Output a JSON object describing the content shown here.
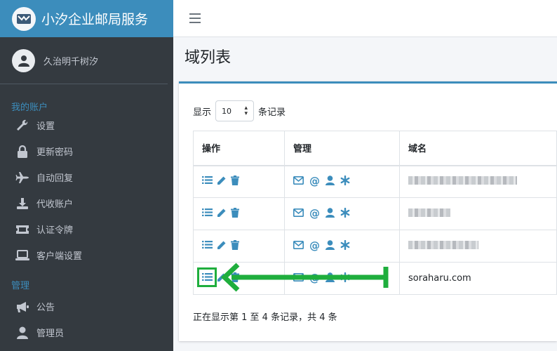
{
  "brand": {
    "title": "小汐企业邮局服务"
  },
  "user": {
    "name": "久治明千树汐"
  },
  "sidebar": {
    "section1": "我的账户",
    "section2": "管理",
    "items": [
      {
        "label": "设置",
        "icon": "wrench-icon"
      },
      {
        "label": "更新密码",
        "icon": "lock-icon"
      },
      {
        "label": "自动回复",
        "icon": "plane-icon"
      },
      {
        "label": "代收账户",
        "icon": "download-icon"
      },
      {
        "label": "认证令牌",
        "icon": "ticket-icon"
      },
      {
        "label": "客户端设置",
        "icon": "laptop-icon"
      },
      {
        "label": "公告",
        "icon": "megaphone-icon"
      },
      {
        "label": "管理员",
        "icon": "user-icon"
      }
    ]
  },
  "page": {
    "title": "域列表"
  },
  "table_controls": {
    "show_label": "显示",
    "page_size": "10",
    "records_label": "条记录"
  },
  "table": {
    "headers": [
      "操作",
      "管理",
      "域名"
    ],
    "rows": [
      {
        "domain": ""
      },
      {
        "domain": ""
      },
      {
        "domain": ""
      },
      {
        "domain": "soraharu.com"
      }
    ]
  },
  "info": "正在显示第 1 至 4 条记录，共 4 条",
  "colors": {
    "accent": "#3c8dbc",
    "sidebar": "#343a40",
    "annotation": "#1fae3d"
  }
}
